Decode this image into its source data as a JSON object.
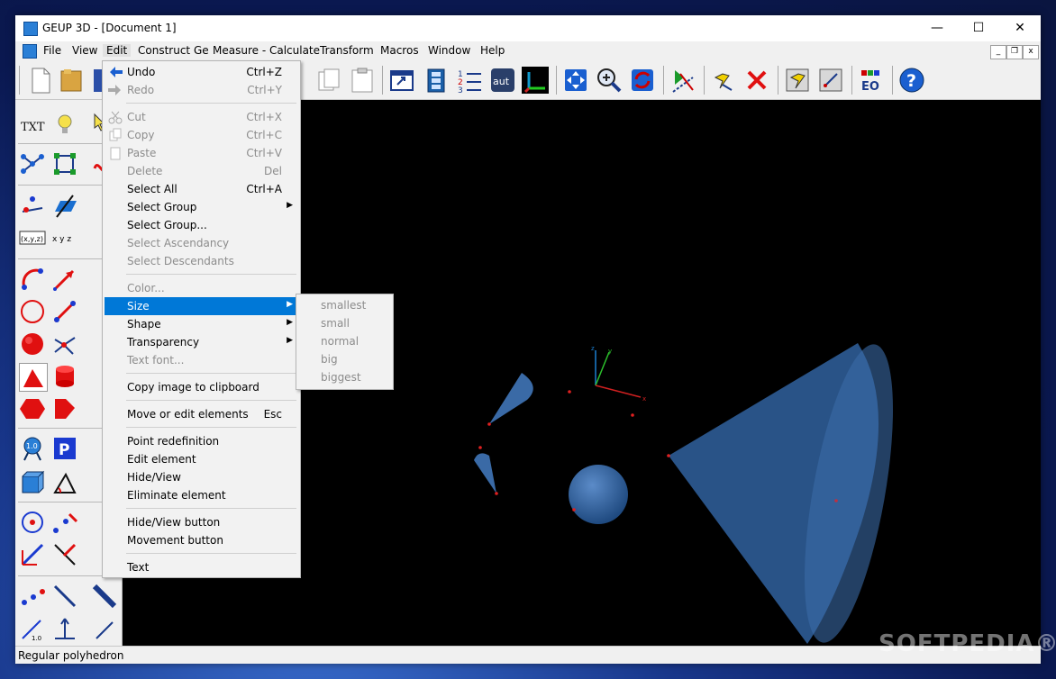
{
  "window": {
    "title": "GEUP 3D - [Document 1]",
    "minimize": "—",
    "maximize": "☐",
    "close": "✕"
  },
  "menu": {
    "items": [
      "File",
      "View",
      "Edit",
      "Construct Ge",
      "Measure - Calculate",
      "Transform",
      "Macros",
      "Window",
      "Help"
    ]
  },
  "edit_menu": {
    "items": [
      {
        "label": "Undo",
        "shortcut": "Ctrl+Z",
        "enabled": true
      },
      {
        "label": "Redo",
        "shortcut": "Ctrl+Y",
        "enabled": false
      },
      {
        "label": "Cut",
        "shortcut": "Ctrl+X",
        "enabled": false
      },
      {
        "label": "Copy",
        "shortcut": "Ctrl+C",
        "enabled": false
      },
      {
        "label": "Paste",
        "shortcut": "Ctrl+V",
        "enabled": false
      },
      {
        "label": "Delete",
        "shortcut": "Del",
        "enabled": false
      },
      {
        "label": "Select All",
        "shortcut": "Ctrl+A",
        "enabled": true
      },
      {
        "label": "Select Group",
        "enabled": true
      },
      {
        "label": "Select Group...",
        "enabled": true
      },
      {
        "label": "Select Ascendancy",
        "enabled": false
      },
      {
        "label": "Select Descendants",
        "enabled": false
      },
      {
        "label": "Color...",
        "enabled": false
      },
      {
        "label": "Size",
        "enabled": true
      },
      {
        "label": "Shape",
        "enabled": true
      },
      {
        "label": "Transparency",
        "enabled": true
      },
      {
        "label": "Text font...",
        "enabled": false
      },
      {
        "label": "Copy image to clipboard",
        "enabled": true
      },
      {
        "label": "Move or edit elements",
        "shortcut": "Esc",
        "enabled": true
      },
      {
        "label": "Point redefinition",
        "enabled": true
      },
      {
        "label": "Edit element",
        "enabled": true
      },
      {
        "label": "Hide/View",
        "enabled": true
      },
      {
        "label": "Eliminate element",
        "enabled": true
      },
      {
        "label": "Hide/View button",
        "enabled": true
      },
      {
        "label": "Movement button",
        "enabled": true
      },
      {
        "label": "Text",
        "enabled": true
      }
    ]
  },
  "size_submenu": {
    "items": [
      "smallest",
      "small",
      "normal",
      "big",
      "biggest"
    ]
  },
  "toolbar_labels": {
    "aut": "aut",
    "eo": "EO",
    "help": "?"
  },
  "left_labels": {
    "txt": "TXT",
    "xyz_box": "(x,y,z)",
    "xyz": "x y z",
    "p": "P",
    "v10": "1.0"
  },
  "axes": {
    "x": "x",
    "y": "y",
    "z": "z"
  },
  "status": {
    "text": "Regular polyhedron"
  },
  "watermark": "SOFTPEDIA®",
  "colors": {
    "highlight": "#0078d7",
    "canvas": "#000000",
    "solid": "#3a6aa6",
    "point": "#e02020"
  }
}
